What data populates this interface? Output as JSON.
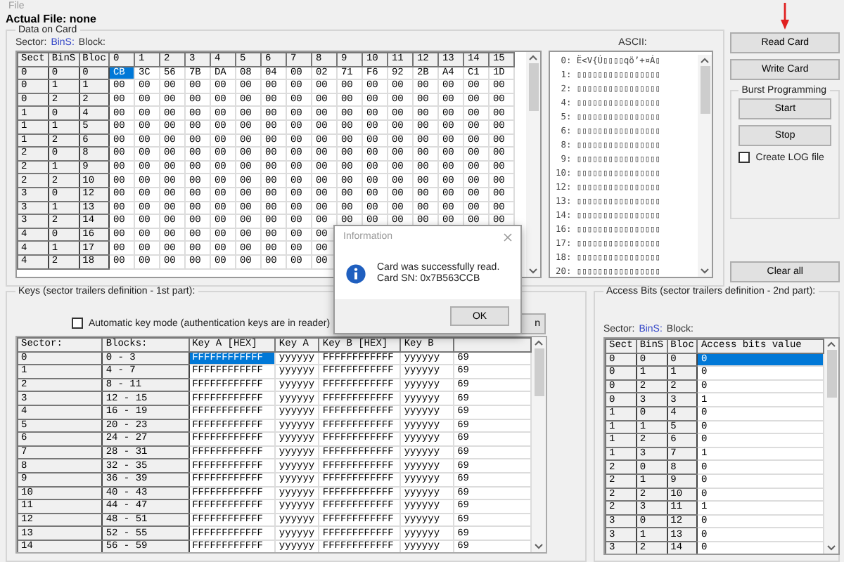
{
  "menu": {
    "items": [
      {
        "label": "File"
      }
    ]
  },
  "actual_file": "Actual File: none",
  "data_on_card": {
    "title": "Data on Card",
    "legend": [
      {
        "label": "Sector:",
        "highlighted": false
      },
      {
        "label": "BinS:",
        "highlighted": true
      },
      {
        "label": "Block:",
        "highlighted": false
      }
    ],
    "ascii_label": "ASCII:",
    "table": {
      "row_header_columns": [
        "Sect",
        "BinS",
        "Bloc"
      ],
      "columns": [
        "0",
        "1",
        "2",
        "3",
        "4",
        "5",
        "6",
        "7",
        "8",
        "9",
        "10",
        "11",
        "12",
        "13",
        "14",
        "15"
      ],
      "rows": [
        {
          "sector": "0",
          "bins": "0",
          "block": "0",
          "cells": [
            {
              "text": "CB",
              "selected": true
            },
            {
              "text": "3C",
              "selected": false
            },
            {
              "text": "56",
              "selected": false
            },
            {
              "text": "7B",
              "selected": false
            },
            {
              "text": "DA",
              "selected": false
            },
            {
              "text": "08",
              "selected": false
            },
            {
              "text": "04",
              "selected": false
            },
            {
              "text": "00",
              "selected": false
            },
            {
              "text": "02",
              "selected": false
            },
            {
              "text": "71",
              "selected": false
            },
            {
              "text": "F6",
              "selected": false
            },
            {
              "text": "92",
              "selected": false
            },
            {
              "text": "2B",
              "selected": false
            },
            {
              "text": "A4",
              "selected": false
            },
            {
              "text": "C1",
              "selected": false
            },
            {
              "text": "1D",
              "selected": false
            }
          ]
        },
        {
          "sector": "0",
          "bins": "1",
          "block": "1",
          "cells": [
            {
              "text": "00",
              "selected": false
            },
            {
              "text": "00",
              "selected": false
            },
            {
              "text": "00",
              "selected": false
            },
            {
              "text": "00",
              "selected": false
            },
            {
              "text": "00",
              "selected": false
            },
            {
              "text": "00",
              "selected": false
            },
            {
              "text": "00",
              "selected": false
            },
            {
              "text": "00",
              "selected": false
            },
            {
              "text": "00",
              "selected": false
            },
            {
              "text": "00",
              "selected": false
            },
            {
              "text": "00",
              "selected": false
            },
            {
              "text": "00",
              "selected": false
            },
            {
              "text": "00",
              "selected": false
            },
            {
              "text": "00",
              "selected": false
            },
            {
              "text": "00",
              "selected": false
            },
            {
              "text": "00",
              "selected": false
            }
          ]
        },
        {
          "sector": "0",
          "bins": "2",
          "block": "2",
          "cells": [
            {
              "text": "00",
              "selected": false
            },
            {
              "text": "00",
              "selected": false
            },
            {
              "text": "00",
              "selected": false
            },
            {
              "text": "00",
              "selected": false
            },
            {
              "text": "00",
              "selected": false
            },
            {
              "text": "00",
              "selected": false
            },
            {
              "text": "00",
              "selected": false
            },
            {
              "text": "00",
              "selected": false
            },
            {
              "text": "00",
              "selected": false
            },
            {
              "text": "00",
              "selected": false
            },
            {
              "text": "00",
              "selected": false
            },
            {
              "text": "00",
              "selected": false
            },
            {
              "text": "00",
              "selected": false
            },
            {
              "text": "00",
              "selected": false
            },
            {
              "text": "00",
              "selected": false
            },
            {
              "text": "00",
              "selected": false
            }
          ]
        },
        {
          "sector": "1",
          "bins": "0",
          "block": "4",
          "cells": [
            {
              "text": "00",
              "selected": false
            },
            {
              "text": "00",
              "selected": false
            },
            {
              "text": "00",
              "selected": false
            },
            {
              "text": "00",
              "selected": false
            },
            {
              "text": "00",
              "selected": false
            },
            {
              "text": "00",
              "selected": false
            },
            {
              "text": "00",
              "selected": false
            },
            {
              "text": "00",
              "selected": false
            },
            {
              "text": "00",
              "selected": false
            },
            {
              "text": "00",
              "selected": false
            },
            {
              "text": "00",
              "selected": false
            },
            {
              "text": "00",
              "selected": false
            },
            {
              "text": "00",
              "selected": false
            },
            {
              "text": "00",
              "selected": false
            },
            {
              "text": "00",
              "selected": false
            },
            {
              "text": "00",
              "selected": false
            }
          ]
        },
        {
          "sector": "1",
          "bins": "1",
          "block": "5",
          "cells": [
            {
              "text": "00",
              "selected": false
            },
            {
              "text": "00",
              "selected": false
            },
            {
              "text": "00",
              "selected": false
            },
            {
              "text": "00",
              "selected": false
            },
            {
              "text": "00",
              "selected": false
            },
            {
              "text": "00",
              "selected": false
            },
            {
              "text": "00",
              "selected": false
            },
            {
              "text": "00",
              "selected": false
            },
            {
              "text": "00",
              "selected": false
            },
            {
              "text": "00",
              "selected": false
            },
            {
              "text": "00",
              "selected": false
            },
            {
              "text": "00",
              "selected": false
            },
            {
              "text": "00",
              "selected": false
            },
            {
              "text": "00",
              "selected": false
            },
            {
              "text": "00",
              "selected": false
            },
            {
              "text": "00",
              "selected": false
            }
          ]
        },
        {
          "sector": "1",
          "bins": "2",
          "block": "6",
          "cells": [
            {
              "text": "00",
              "selected": false
            },
            {
              "text": "00",
              "selected": false
            },
            {
              "text": "00",
              "selected": false
            },
            {
              "text": "00",
              "selected": false
            },
            {
              "text": "00",
              "selected": false
            },
            {
              "text": "00",
              "selected": false
            },
            {
              "text": "00",
              "selected": false
            },
            {
              "text": "00",
              "selected": false
            },
            {
              "text": "00",
              "selected": false
            },
            {
              "text": "00",
              "selected": false
            },
            {
              "text": "00",
              "selected": false
            },
            {
              "text": "00",
              "selected": false
            },
            {
              "text": "00",
              "selected": false
            },
            {
              "text": "00",
              "selected": false
            },
            {
              "text": "00",
              "selected": false
            },
            {
              "text": "00",
              "selected": false
            }
          ]
        },
        {
          "sector": "2",
          "bins": "0",
          "block": "8",
          "cells": [
            {
              "text": "00",
              "selected": false
            },
            {
              "text": "00",
              "selected": false
            },
            {
              "text": "00",
              "selected": false
            },
            {
              "text": "00",
              "selected": false
            },
            {
              "text": "00",
              "selected": false
            },
            {
              "text": "00",
              "selected": false
            },
            {
              "text": "00",
              "selected": false
            },
            {
              "text": "00",
              "selected": false
            },
            {
              "text": "00",
              "selected": false
            },
            {
              "text": "00",
              "selected": false
            },
            {
              "text": "00",
              "selected": false
            },
            {
              "text": "00",
              "selected": false
            },
            {
              "text": "00",
              "selected": false
            },
            {
              "text": "00",
              "selected": false
            },
            {
              "text": "00",
              "selected": false
            },
            {
              "text": "00",
              "selected": false
            }
          ]
        },
        {
          "sector": "2",
          "bins": "1",
          "block": "9",
          "cells": [
            {
              "text": "00",
              "selected": false
            },
            {
              "text": "00",
              "selected": false
            },
            {
              "text": "00",
              "selected": false
            },
            {
              "text": "00",
              "selected": false
            },
            {
              "text": "00",
              "selected": false
            },
            {
              "text": "00",
              "selected": false
            },
            {
              "text": "00",
              "selected": false
            },
            {
              "text": "00",
              "selected": false
            },
            {
              "text": "00",
              "selected": false
            },
            {
              "text": "00",
              "selected": false
            },
            {
              "text": "00",
              "selected": false
            },
            {
              "text": "00",
              "selected": false
            },
            {
              "text": "00",
              "selected": false
            },
            {
              "text": "00",
              "selected": false
            },
            {
              "text": "00",
              "selected": false
            },
            {
              "text": "00",
              "selected": false
            }
          ]
        },
        {
          "sector": "2",
          "bins": "2",
          "block": "10",
          "cells": [
            {
              "text": "00",
              "selected": false
            },
            {
              "text": "00",
              "selected": false
            },
            {
              "text": "00",
              "selected": false
            },
            {
              "text": "00",
              "selected": false
            },
            {
              "text": "00",
              "selected": false
            },
            {
              "text": "00",
              "selected": false
            },
            {
              "text": "00",
              "selected": false
            },
            {
              "text": "00",
              "selected": false
            },
            {
              "text": "00",
              "selected": false
            },
            {
              "text": "00",
              "selected": false
            },
            {
              "text": "00",
              "selected": false
            },
            {
              "text": "00",
              "selected": false
            },
            {
              "text": "00",
              "selected": false
            },
            {
              "text": "00",
              "selected": false
            },
            {
              "text": "00",
              "selected": false
            },
            {
              "text": "00",
              "selected": false
            }
          ]
        },
        {
          "sector": "3",
          "bins": "0",
          "block": "12",
          "cells": [
            {
              "text": "00",
              "selected": false
            },
            {
              "text": "00",
              "selected": false
            },
            {
              "text": "00",
              "selected": false
            },
            {
              "text": "00",
              "selected": false
            },
            {
              "text": "00",
              "selected": false
            },
            {
              "text": "00",
              "selected": false
            },
            {
              "text": "00",
              "selected": false
            },
            {
              "text": "00",
              "selected": false
            },
            {
              "text": "00",
              "selected": false
            },
            {
              "text": "00",
              "selected": false
            },
            {
              "text": "00",
              "selected": false
            },
            {
              "text": "00",
              "selected": false
            },
            {
              "text": "00",
              "selected": false
            },
            {
              "text": "00",
              "selected": false
            },
            {
              "text": "00",
              "selected": false
            },
            {
              "text": "00",
              "selected": false
            }
          ]
        },
        {
          "sector": "3",
          "bins": "1",
          "block": "13",
          "cells": [
            {
              "text": "00",
              "selected": false
            },
            {
              "text": "00",
              "selected": false
            },
            {
              "text": "00",
              "selected": false
            },
            {
              "text": "00",
              "selected": false
            },
            {
              "text": "00",
              "selected": false
            },
            {
              "text": "00",
              "selected": false
            },
            {
              "text": "00",
              "selected": false
            },
            {
              "text": "00",
              "selected": false
            },
            {
              "text": "00",
              "selected": false
            },
            {
              "text": "00",
              "selected": false
            },
            {
              "text": "00",
              "selected": false
            },
            {
              "text": "00",
              "selected": false
            },
            {
              "text": "00",
              "selected": false
            },
            {
              "text": "00",
              "selected": false
            },
            {
              "text": "00",
              "selected": false
            },
            {
              "text": "00",
              "selected": false
            }
          ]
        },
        {
          "sector": "3",
          "bins": "2",
          "block": "14",
          "cells": [
            {
              "text": "00",
              "selected": false
            },
            {
              "text": "00",
              "selected": false
            },
            {
              "text": "00",
              "selected": false
            },
            {
              "text": "00",
              "selected": false
            },
            {
              "text": "00",
              "selected": false
            },
            {
              "text": "00",
              "selected": false
            },
            {
              "text": "00",
              "selected": false
            },
            {
              "text": "00",
              "selected": false
            },
            {
              "text": "00",
              "selected": false
            },
            {
              "text": "00",
              "selected": false
            },
            {
              "text": "00",
              "selected": false
            },
            {
              "text": "00",
              "selected": false
            },
            {
              "text": "00",
              "selected": false
            },
            {
              "text": "00",
              "selected": false
            },
            {
              "text": "00",
              "selected": false
            },
            {
              "text": "00",
              "selected": false
            }
          ]
        },
        {
          "sector": "4",
          "bins": "0",
          "block": "16",
          "cells": [
            {
              "text": "00",
              "selected": false
            },
            {
              "text": "00",
              "selected": false
            },
            {
              "text": "00",
              "selected": false
            },
            {
              "text": "00",
              "selected": false
            },
            {
              "text": "00",
              "selected": false
            },
            {
              "text": "00",
              "selected": false
            },
            {
              "text": "00",
              "selected": false
            },
            {
              "text": "00",
              "selected": false
            },
            {
              "text": "00",
              "selected": false
            }
          ]
        },
        {
          "sector": "4",
          "bins": "1",
          "block": "17",
          "cells": [
            {
              "text": "00",
              "selected": false
            },
            {
              "text": "00",
              "selected": false
            },
            {
              "text": "00",
              "selected": false
            },
            {
              "text": "00",
              "selected": false
            },
            {
              "text": "00",
              "selected": false
            },
            {
              "text": "00",
              "selected": false
            },
            {
              "text": "00",
              "selected": false
            },
            {
              "text": "00",
              "selected": false
            },
            {
              "text": "00",
              "selected": false
            }
          ]
        },
        {
          "sector": "4",
          "bins": "2",
          "block": "18",
          "cells": [
            {
              "text": "00",
              "selected": false
            },
            {
              "text": "00",
              "selected": false
            },
            {
              "text": "00",
              "selected": false
            },
            {
              "text": "00",
              "selected": false
            },
            {
              "text": "00",
              "selected": false
            },
            {
              "text": "00",
              "selected": false
            },
            {
              "text": "00",
              "selected": false
            },
            {
              "text": "00",
              "selected": false
            },
            {
              "text": "00",
              "selected": false
            }
          ]
        }
      ]
    },
    "ascii_lines": [
      " 0: Ë<V{Ú▯▯▯▯qö’+¤Á▯",
      " 1: ▯▯▯▯▯▯▯▯▯▯▯▯▯▯▯▯",
      " 2: ▯▯▯▯▯▯▯▯▯▯▯▯▯▯▯▯",
      " 4: ▯▯▯▯▯▯▯▯▯▯▯▯▯▯▯▯",
      " 5: ▯▯▯▯▯▯▯▯▯▯▯▯▯▯▯▯",
      " 6: ▯▯▯▯▯▯▯▯▯▯▯▯▯▯▯▯",
      " 8: ▯▯▯▯▯▯▯▯▯▯▯▯▯▯▯▯",
      " 9: ▯▯▯▯▯▯▯▯▯▯▯▯▯▯▯▯",
      "10: ▯▯▯▯▯▯▯▯▯▯▯▯▯▯▯▯",
      "12: ▯▯▯▯▯▯▯▯▯▯▯▯▯▯▯▯",
      "13: ▯▯▯▯▯▯▯▯▯▯▯▯▯▯▯▯",
      "14: ▯▯▯▯▯▯▯▯▯▯▯▯▯▯▯▯",
      "16: ▯▯▯▯▯▯▯▯▯▯▯▯▯▯▯▯",
      "17: ▯▯▯▯▯▯▯▯▯▯▯▯▯▯▯▯",
      "18: ▯▯▯▯▯▯▯▯▯▯▯▯▯▯▯▯",
      "20: ▯▯▯▯▯▯▯▯▯▯▯▯▯▯▯▯"
    ]
  },
  "actions": {
    "read_card": "Read Card",
    "write_card": "Write Card",
    "burst": {
      "title": "Burst Programming",
      "start": "Start",
      "stop": "Stop",
      "log": {
        "label": "Create LOG file",
        "checked": false
      }
    },
    "clear_all": "Clear all"
  },
  "keys": {
    "title": "Keys (sector trailers definition - 1st part):",
    "auto_mode": {
      "label": "Automatic key mode (authentication keys are in reader)",
      "checked": false
    },
    "button": "n",
    "table": {
      "row_header_columns": [
        "Sector:",
        "Blocks:"
      ],
      "columns": [
        "Key A [HEX]",
        "Key A",
        "Key B [HEX]",
        "Key B"
      ],
      "rows": [
        {
          "sector": "0",
          "blocks": "0 - 3",
          "cells": [
            {
              "text": "FFFFFFFFFFFF",
              "selected": true
            },
            {
              "text": "yyyyyy",
              "selected": false
            },
            {
              "text": "FFFFFFFFFFFF",
              "selected": false
            },
            {
              "text": "yyyyyy",
              "selected": false
            },
            {
              "text": "69",
              "selected": false
            }
          ]
        },
        {
          "sector": "1",
          "blocks": "4 - 7",
          "cells": [
            {
              "text": "FFFFFFFFFFFF",
              "selected": false
            },
            {
              "text": "yyyyyy",
              "selected": false
            },
            {
              "text": "FFFFFFFFFFFF",
              "selected": false
            },
            {
              "text": "yyyyyy",
              "selected": false
            },
            {
              "text": "69",
              "selected": false
            }
          ]
        },
        {
          "sector": "2",
          "blocks": "8 - 11",
          "cells": [
            {
              "text": "FFFFFFFFFFFF",
              "selected": false
            },
            {
              "text": "yyyyyy",
              "selected": false
            },
            {
              "text": "FFFFFFFFFFFF",
              "selected": false
            },
            {
              "text": "yyyyyy",
              "selected": false
            },
            {
              "text": "69",
              "selected": false
            }
          ]
        },
        {
          "sector": "3",
          "blocks": "12 - 15",
          "cells": [
            {
              "text": "FFFFFFFFFFFF",
              "selected": false
            },
            {
              "text": "yyyyyy",
              "selected": false
            },
            {
              "text": "FFFFFFFFFFFF",
              "selected": false
            },
            {
              "text": "yyyyyy",
              "selected": false
            },
            {
              "text": "69",
              "selected": false
            }
          ]
        },
        {
          "sector": "4",
          "blocks": "16 - 19",
          "cells": [
            {
              "text": "FFFFFFFFFFFF",
              "selected": false
            },
            {
              "text": "yyyyyy",
              "selected": false
            },
            {
              "text": "FFFFFFFFFFFF",
              "selected": false
            },
            {
              "text": "yyyyyy",
              "selected": false
            },
            {
              "text": "69",
              "selected": false
            }
          ]
        },
        {
          "sector": "5",
          "blocks": "20 - 23",
          "cells": [
            {
              "text": "FFFFFFFFFFFF",
              "selected": false
            },
            {
              "text": "yyyyyy",
              "selected": false
            },
            {
              "text": "FFFFFFFFFFFF",
              "selected": false
            },
            {
              "text": "yyyyyy",
              "selected": false
            },
            {
              "text": "69",
              "selected": false
            }
          ]
        },
        {
          "sector": "6",
          "blocks": "24 - 27",
          "cells": [
            {
              "text": "FFFFFFFFFFFF",
              "selected": false
            },
            {
              "text": "yyyyyy",
              "selected": false
            },
            {
              "text": "FFFFFFFFFFFF",
              "selected": false
            },
            {
              "text": "yyyyyy",
              "selected": false
            },
            {
              "text": "69",
              "selected": false
            }
          ]
        },
        {
          "sector": "7",
          "blocks": "28 - 31",
          "cells": [
            {
              "text": "FFFFFFFFFFFF",
              "selected": false
            },
            {
              "text": "yyyyyy",
              "selected": false
            },
            {
              "text": "FFFFFFFFFFFF",
              "selected": false
            },
            {
              "text": "yyyyyy",
              "selected": false
            },
            {
              "text": "69",
              "selected": false
            }
          ]
        },
        {
          "sector": "8",
          "blocks": "32 - 35",
          "cells": [
            {
              "text": "FFFFFFFFFFFF",
              "selected": false
            },
            {
              "text": "yyyyyy",
              "selected": false
            },
            {
              "text": "FFFFFFFFFFFF",
              "selected": false
            },
            {
              "text": "yyyyyy",
              "selected": false
            },
            {
              "text": "69",
              "selected": false
            }
          ]
        },
        {
          "sector": "9",
          "blocks": "36 - 39",
          "cells": [
            {
              "text": "FFFFFFFFFFFF",
              "selected": false
            },
            {
              "text": "yyyyyy",
              "selected": false
            },
            {
              "text": "FFFFFFFFFFFF",
              "selected": false
            },
            {
              "text": "yyyyyy",
              "selected": false
            },
            {
              "text": "69",
              "selected": false
            }
          ]
        },
        {
          "sector": "10",
          "blocks": "40 - 43",
          "cells": [
            {
              "text": "FFFFFFFFFFFF",
              "selected": false
            },
            {
              "text": "yyyyyy",
              "selected": false
            },
            {
              "text": "FFFFFFFFFFFF",
              "selected": false
            },
            {
              "text": "yyyyyy",
              "selected": false
            },
            {
              "text": "69",
              "selected": false
            }
          ]
        },
        {
          "sector": "11",
          "blocks": "44 - 47",
          "cells": [
            {
              "text": "FFFFFFFFFFFF",
              "selected": false
            },
            {
              "text": "yyyyyy",
              "selected": false
            },
            {
              "text": "FFFFFFFFFFFF",
              "selected": false
            },
            {
              "text": "yyyyyy",
              "selected": false
            },
            {
              "text": "69",
              "selected": false
            }
          ]
        },
        {
          "sector": "12",
          "blocks": "48 - 51",
          "cells": [
            {
              "text": "FFFFFFFFFFFF",
              "selected": false
            },
            {
              "text": "yyyyyy",
              "selected": false
            },
            {
              "text": "FFFFFFFFFFFF",
              "selected": false
            },
            {
              "text": "yyyyyy",
              "selected": false
            },
            {
              "text": "69",
              "selected": false
            }
          ]
        },
        {
          "sector": "13",
          "blocks": "52 - 55",
          "cells": [
            {
              "text": "FFFFFFFFFFFF",
              "selected": false
            },
            {
              "text": "yyyyyy",
              "selected": false
            },
            {
              "text": "FFFFFFFFFFFF",
              "selected": false
            },
            {
              "text": "yyyyyy",
              "selected": false
            },
            {
              "text": "69",
              "selected": false
            }
          ]
        },
        {
          "sector": "14",
          "blocks": "56 - 59",
          "cells": [
            {
              "text": "FFFFFFFFFFFF",
              "selected": false
            },
            {
              "text": "yyyyyy",
              "selected": false
            },
            {
              "text": "FFFFFFFFFFFF",
              "selected": false
            },
            {
              "text": "yyyyyy",
              "selected": false
            },
            {
              "text": "69",
              "selected": false
            }
          ]
        }
      ]
    }
  },
  "access_bits": {
    "title": "Access Bits (sector trailers definition - 2nd part):",
    "legend": [
      {
        "label": "Sector:",
        "highlighted": false
      },
      {
        "label": "BinS:",
        "highlighted": true
      },
      {
        "label": "Block:",
        "highlighted": false
      }
    ],
    "table": {
      "row_header_columns": [
        "Sect",
        "BinS",
        "Bloc"
      ],
      "columns": [
        "Access bits value"
      ],
      "rows": [
        {
          "sector": "0",
          "bins": "0",
          "block": "0",
          "value": "0",
          "selected": true
        },
        {
          "sector": "0",
          "bins": "1",
          "block": "1",
          "value": "0",
          "selected": false
        },
        {
          "sector": "0",
          "bins": "2",
          "block": "2",
          "value": "0",
          "selected": false
        },
        {
          "sector": "0",
          "bins": "3",
          "block": "3",
          "value": "1",
          "selected": false
        },
        {
          "sector": "1",
          "bins": "0",
          "block": "4",
          "value": "0",
          "selected": false
        },
        {
          "sector": "1",
          "bins": "1",
          "block": "5",
          "value": "0",
          "selected": false
        },
        {
          "sector": "1",
          "bins": "2",
          "block": "6",
          "value": "0",
          "selected": false
        },
        {
          "sector": "1",
          "bins": "3",
          "block": "7",
          "value": "1",
          "selected": false
        },
        {
          "sector": "2",
          "bins": "0",
          "block": "8",
          "value": "0",
          "selected": false
        },
        {
          "sector": "2",
          "bins": "1",
          "block": "9",
          "value": "0",
          "selected": false
        },
        {
          "sector": "2",
          "bins": "2",
          "block": "10",
          "value": "0",
          "selected": false
        },
        {
          "sector": "2",
          "bins": "3",
          "block": "11",
          "value": "1",
          "selected": false
        },
        {
          "sector": "3",
          "bins": "0",
          "block": "12",
          "value": "0",
          "selected": false
        },
        {
          "sector": "3",
          "bins": "1",
          "block": "13",
          "value": "0",
          "selected": false
        },
        {
          "sector": "3",
          "bins": "2",
          "block": "14",
          "value": "0",
          "selected": false
        }
      ]
    }
  },
  "dialog": {
    "title": "Information",
    "lines": [
      "Card was successfully read.",
      "Card SN: 0x7B563CCB"
    ],
    "button": "OK"
  }
}
